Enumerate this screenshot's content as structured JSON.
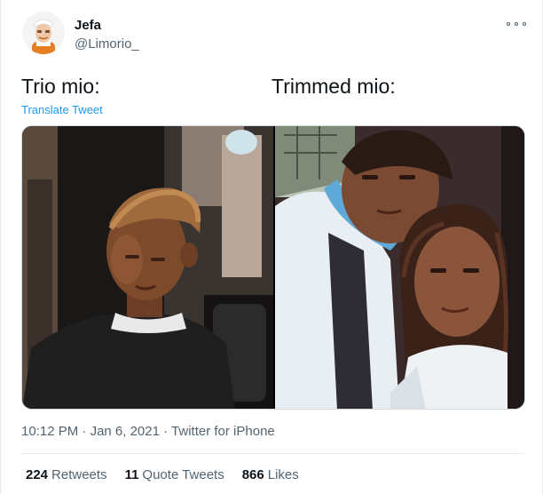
{
  "author": {
    "display_name": "Jefa",
    "handle": "@Limorio_"
  },
  "tweet": {
    "text_left": "Trio mio:",
    "text_right": "Trimmed mio:",
    "translate_label": "Translate Tweet"
  },
  "meta": {
    "time": "10:12 PM",
    "date": "Jan 6, 2021",
    "source": "Twitter for iPhone",
    "separator": "·"
  },
  "stats": {
    "retweets": {
      "count": "224",
      "label": "Retweets"
    },
    "quote_tweets": {
      "count": "11",
      "label": "Quote Tweets"
    },
    "likes": {
      "count": "866",
      "label": "Likes"
    }
  },
  "icons": {
    "more": "more-options-icon"
  },
  "colors": {
    "link": "#1d9bf0",
    "secondary_text": "#536471",
    "primary_text": "#0f1419",
    "divider": "#e6ecf0"
  }
}
